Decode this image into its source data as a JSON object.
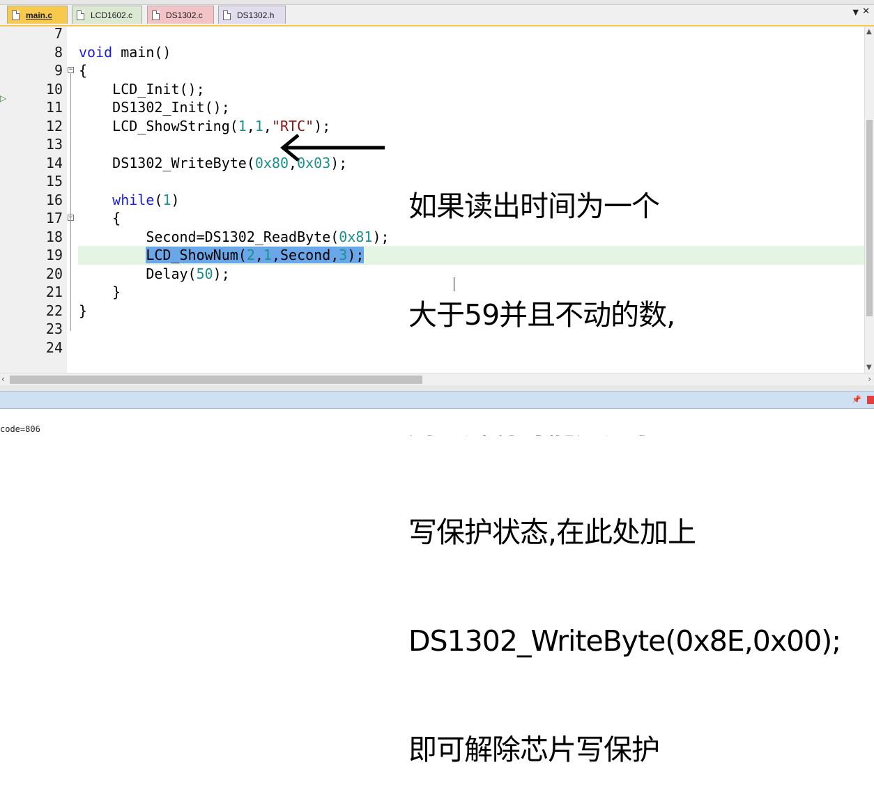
{
  "tabs": [
    {
      "label": "main.c",
      "active": true,
      "color": "#f7c94d"
    },
    {
      "label": "LCD1602.c",
      "color": "#dbe8d2"
    },
    {
      "label": "DS1302.c",
      "color": "#f4c3c7"
    },
    {
      "label": "DS1302.h",
      "color": "#e2dcef"
    }
  ],
  "tabbar_icons": {
    "dropdown": "dropdown-arrow-icon",
    "close": "close-icon"
  },
  "editor": {
    "lines": [
      {
        "num": "7",
        "code": ""
      },
      {
        "num": "8",
        "code": "void main()"
      },
      {
        "num": "9",
        "code": "{"
      },
      {
        "num": "10",
        "code": "    LCD_Init();"
      },
      {
        "num": "11",
        "code": "    DS1302_Init();"
      },
      {
        "num": "12",
        "code": "    LCD_ShowString(1,1,\"RTC\");"
      },
      {
        "num": "13",
        "code": ""
      },
      {
        "num": "14",
        "code": "    DS1302_WriteByte(0x80,0x03);"
      },
      {
        "num": "15",
        "code": ""
      },
      {
        "num": "16",
        "code": "    while(1)"
      },
      {
        "num": "17",
        "code": "    {"
      },
      {
        "num": "18",
        "code": "        Second=DS1302_ReadByte(0x81);"
      },
      {
        "num": "19",
        "code": "        LCD_ShowNum(2,1,Second,3);"
      },
      {
        "num": "20",
        "code": "        Delay(50);"
      },
      {
        "num": "21",
        "code": "    }"
      },
      {
        "num": "22",
        "code": "}"
      },
      {
        "num": "23",
        "code": ""
      },
      {
        "num": "24",
        "code": ""
      }
    ],
    "current_line": "19",
    "selected_text": "LCD_ShowNum(2,1,Second,3);"
  },
  "annotation": {
    "lines": [
      "如果读出时间为一个",
      "大于59并且不动的数,",
      "则芯片有可能是处于",
      "写保护状态,在此处加上",
      "DS1302_WriteByte(0x8E,0x00);",
      "即可解除芯片写保护"
    ]
  },
  "output": {
    "text": "code=806"
  },
  "colors": {
    "keyword": "#1b1bdb",
    "number": "#1c8f8f",
    "string": "#8a1414",
    "selection": "#6aa7e8",
    "current_line": "#e4f5e4",
    "active_tab": "#f7c94d",
    "output_header": "#cfe0f3"
  }
}
